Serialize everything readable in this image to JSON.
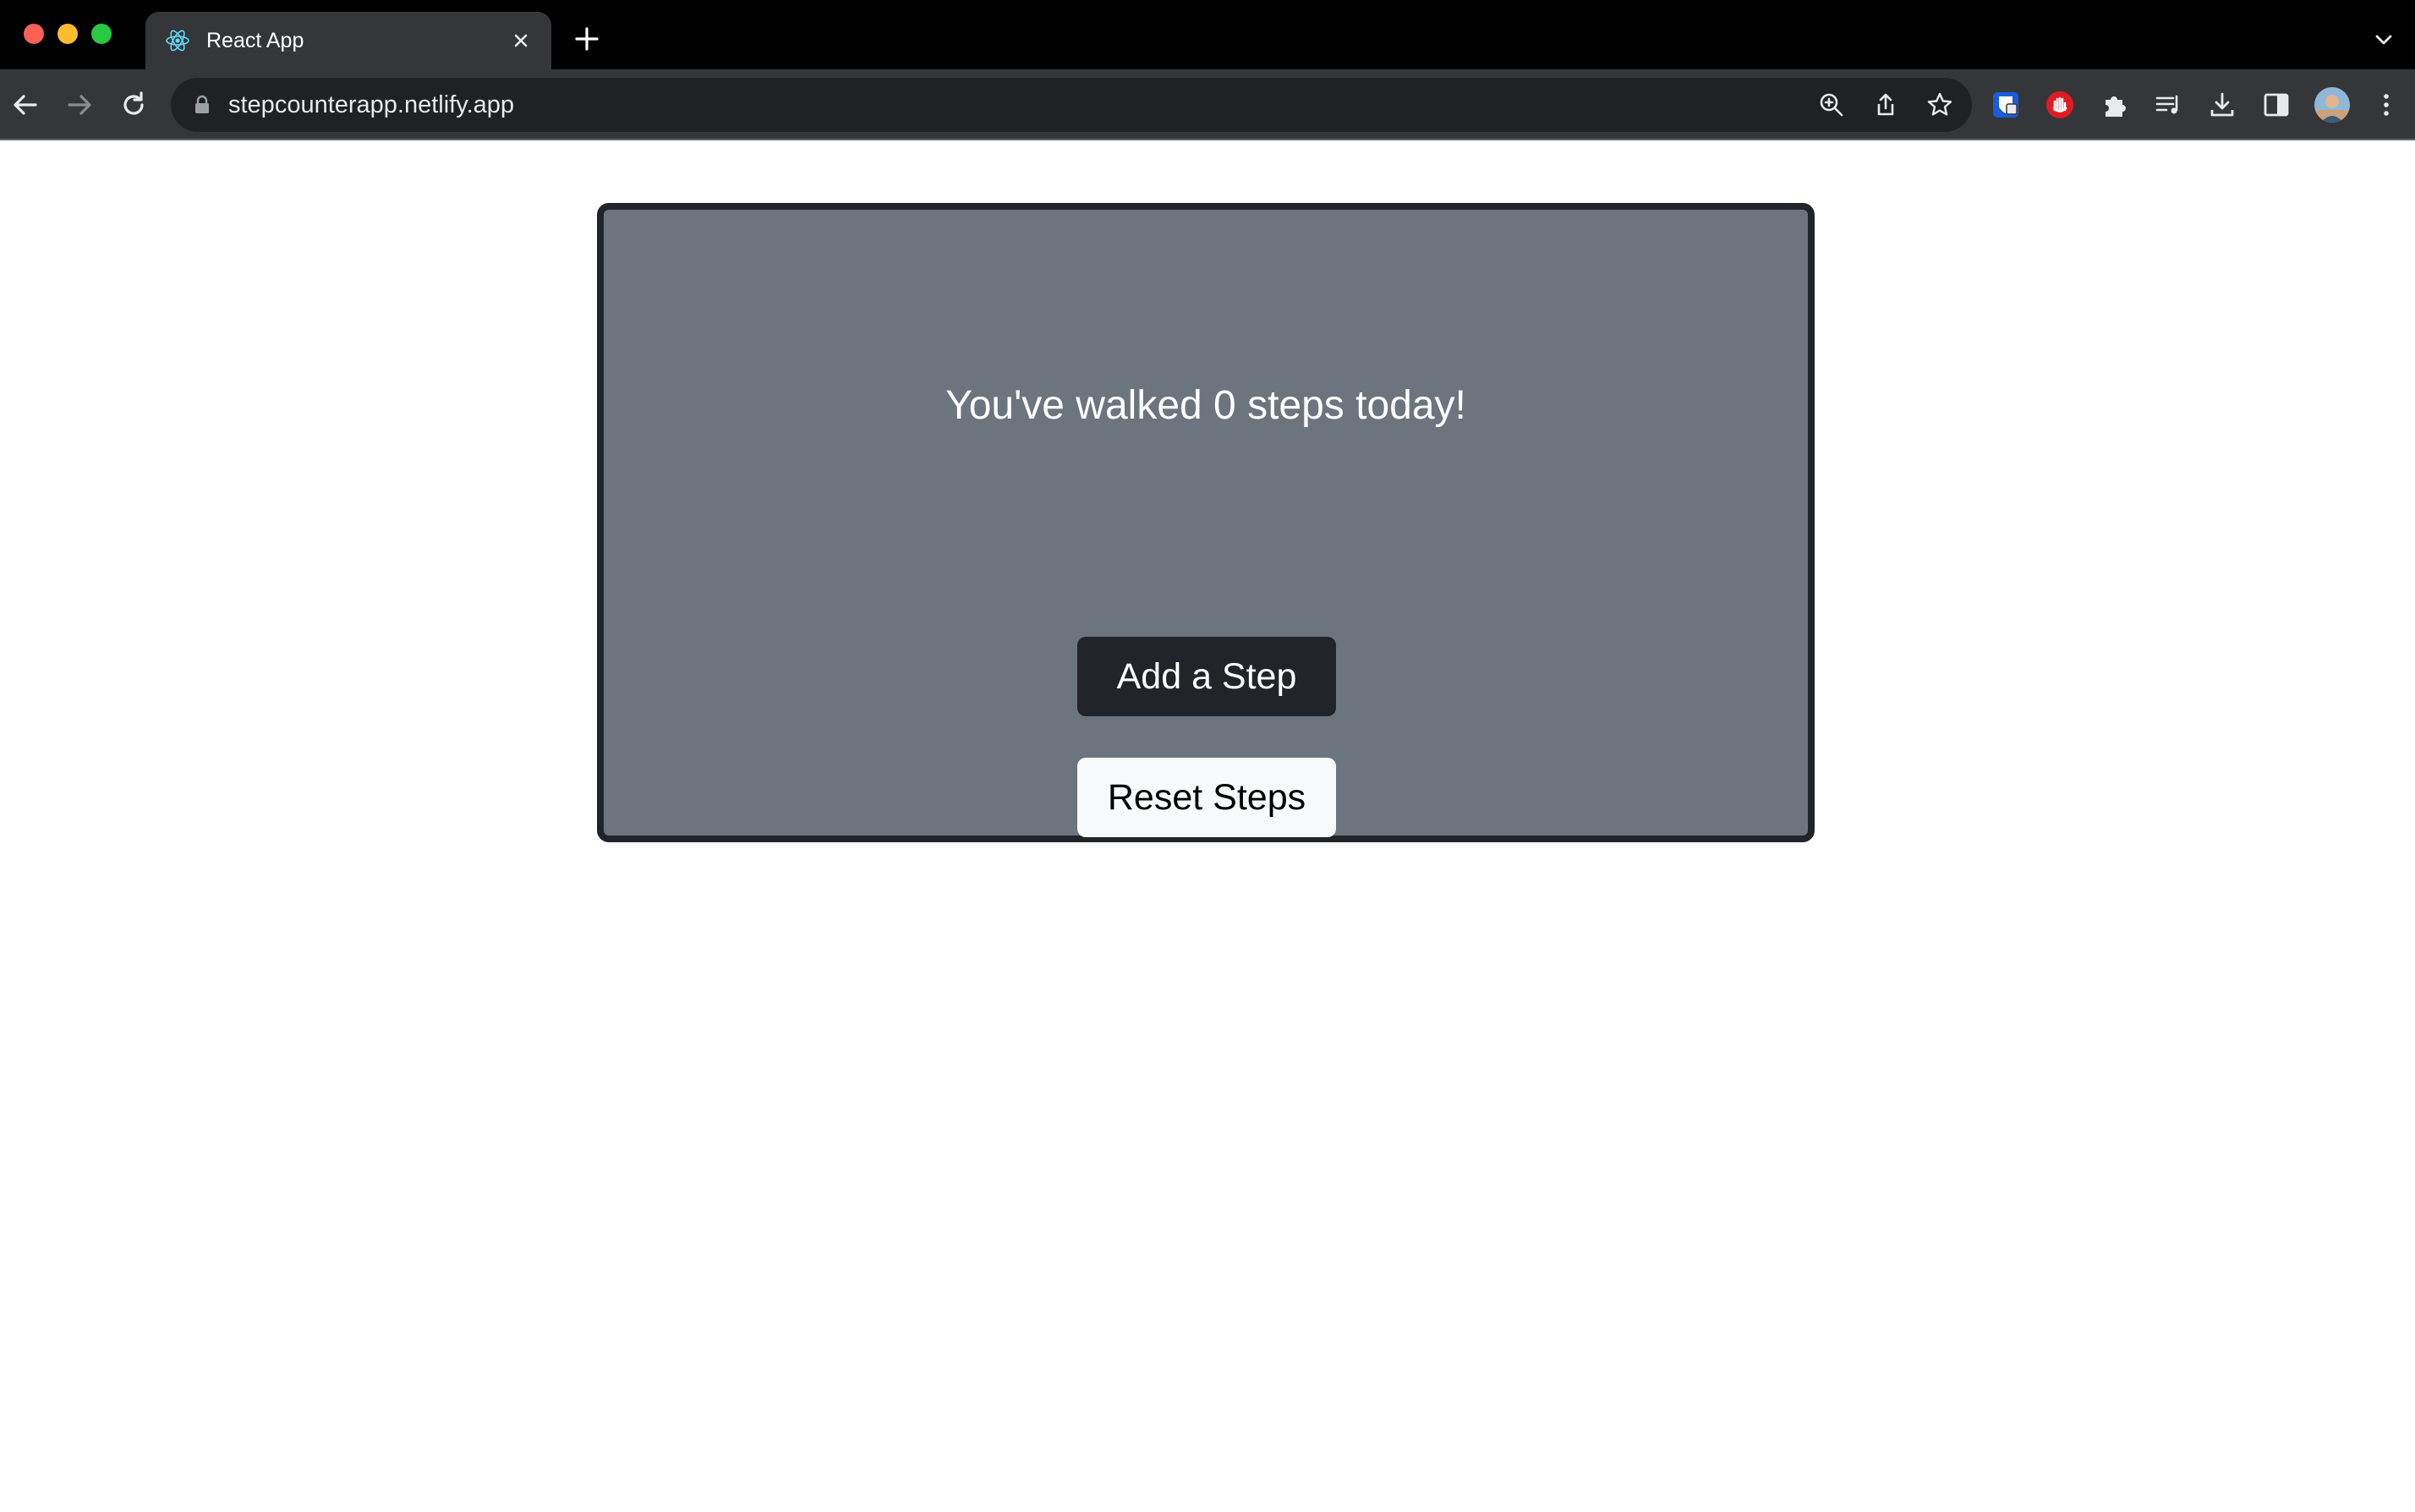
{
  "browser": {
    "tab": {
      "title": "React App",
      "favicon": "react-logo-icon"
    },
    "address_bar": {
      "url": "stepcounterapp.netlify.app"
    },
    "toolbar_icons": [
      "zoom-icon",
      "share-icon",
      "bookmark-star-icon",
      "bitwarden-extension-icon",
      "adblock-extension-icon",
      "extensions-puzzle-icon",
      "media-control-icon",
      "download-icon",
      "side-panel-icon",
      "profile-avatar",
      "menu-kebab-icon"
    ],
    "colors": {
      "tabbar": "#000000",
      "toolbar": "#35363a",
      "omnibox": "#202124"
    }
  },
  "app": {
    "message": "You've walked 0 steps today!",
    "add_button_label": "Add a Step",
    "reset_button_label": "Reset Steps",
    "colors": {
      "card_background": "#6c757d",
      "card_border": "#212529",
      "add_button": "#212529",
      "reset_button": "#f8f9fa"
    }
  }
}
